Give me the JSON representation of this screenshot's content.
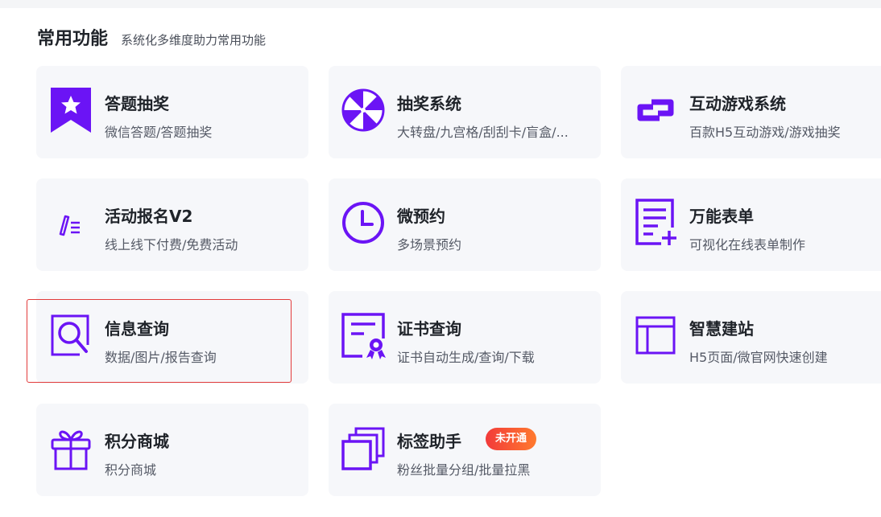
{
  "section": {
    "title": "常用功能",
    "subtitle": "系统化多维度助力常用功能"
  },
  "accent_color": "#6b14f5",
  "cards": [
    {
      "name": "答题抽奖",
      "desc": "微信答题/答题抽奖",
      "icon": "ribbon-star-icon"
    },
    {
      "name": "抽奖系统",
      "desc": "大转盘/九宫格/刮刮卡/盲盒/...",
      "icon": "lottery-wheel-icon"
    },
    {
      "name": "互动游戏系统",
      "desc": "百款H5互动游戏/游戏抽奖",
      "icon": "link-chain-icon"
    },
    {
      "name": "活动报名V2",
      "desc": "线上线下付费/免费活动",
      "icon": "pen-list-icon"
    },
    {
      "name": "微预约",
      "desc": "多场景预约",
      "icon": "clock-icon"
    },
    {
      "name": "万能表单",
      "desc": "可视化在线表单制作",
      "icon": "form-add-icon"
    },
    {
      "name": "信息查询",
      "desc": "数据/图片/报告查询",
      "icon": "search-doc-icon"
    },
    {
      "name": "证书查询",
      "desc": "证书自动生成/查询/下载",
      "icon": "certificate-icon"
    },
    {
      "name": "智慧建站",
      "desc": "H5页面/微官网快速创建",
      "icon": "layout-icon"
    },
    {
      "name": "积分商城",
      "desc": "积分商城",
      "icon": "gift-icon"
    },
    {
      "name": "标签助手",
      "desc": "粉丝批量分组/批量拉黑",
      "icon": "stack-pages-icon",
      "badge": "未开通"
    }
  ]
}
